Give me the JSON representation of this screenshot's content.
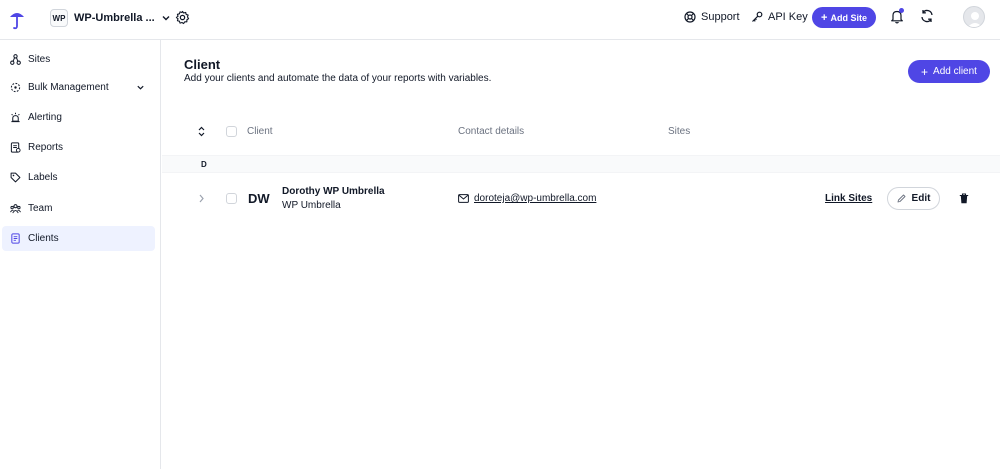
{
  "header": {
    "workspace_badge": "WP",
    "workspace_name": "WP-Umbrella ...",
    "support_label": "Support",
    "api_key_label": "API Key",
    "add_site_label": "Add Site"
  },
  "sidebar": {
    "items": [
      {
        "label": "Sites",
        "icon": "sites-icon"
      },
      {
        "label": "Bulk Management",
        "icon": "bulk-management-icon"
      },
      {
        "label": "Alerting",
        "icon": "alerting-icon"
      },
      {
        "label": "Reports",
        "icon": "reports-icon"
      },
      {
        "label": "Labels",
        "icon": "labels-icon"
      },
      {
        "label": "Team",
        "icon": "team-icon"
      },
      {
        "label": "Clients",
        "icon": "clients-icon"
      }
    ],
    "active": "Clients"
  },
  "main": {
    "title": "Client",
    "subtitle": "Add your clients and automate the data of your reports with variables.",
    "add_client_label": "Add client",
    "columns": [
      "Client",
      "Contact details",
      "Sites"
    ],
    "groups": [
      {
        "letter": "D",
        "rows": [
          {
            "initials": "DW",
            "name": "Dorothy WP Umbrella",
            "company": "WP Umbrella",
            "email": "doroteja@wp-umbrella.com",
            "link_sites_label": "Link Sites",
            "edit_label": "Edit"
          }
        ]
      }
    ]
  },
  "colors": {
    "accent": "#4f46e5",
    "active_nav_bg": "#eef2ff",
    "border": "#e5e7eb"
  }
}
